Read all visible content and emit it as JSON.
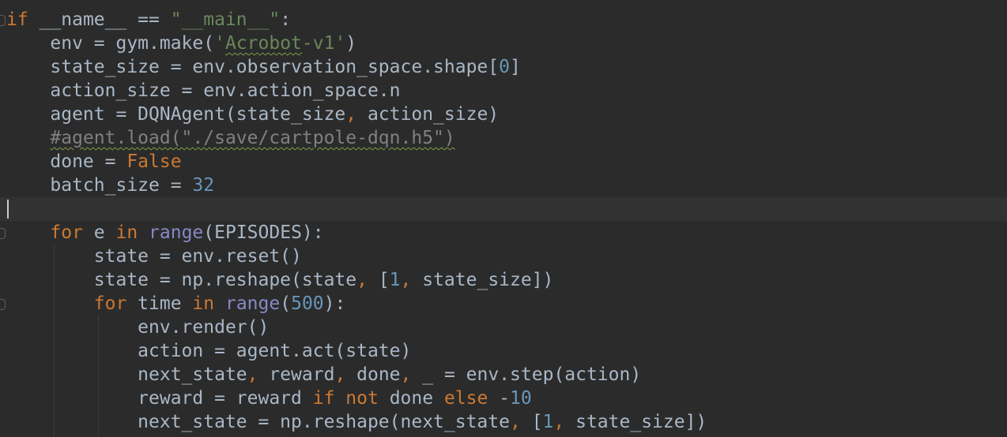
{
  "editor": {
    "language": "python",
    "theme_colors": {
      "background": "#2b2b2b",
      "text": "#a9b7c6",
      "keyword": "#cc7832",
      "string": "#6a8759",
      "number": "#6897bb",
      "builtin": "#8888c6",
      "comment": "#808080"
    },
    "lines": [
      [
        {
          "t": "if",
          "c": "kw"
        },
        {
          "t": " __name__ == "
        },
        {
          "t": "\"__main__\"",
          "c": "str"
        },
        {
          "t": ":"
        }
      ],
      [
        {
          "t": "    env = gym.make("
        },
        {
          "t": "'",
          "c": "str"
        },
        {
          "t": "Acrobot",
          "c": "str sq"
        },
        {
          "t": "-v1'",
          "c": "str"
        },
        {
          "t": ")"
        }
      ],
      [
        {
          "t": "    state_size = env.observation_space.shape["
        },
        {
          "t": "0",
          "c": "num"
        },
        {
          "t": "]"
        }
      ],
      [
        {
          "t": "    action_size = env.action_space.n"
        }
      ],
      [
        {
          "t": "    agent = DQNAgent(state_size"
        },
        {
          "t": ",",
          "c": "kw"
        },
        {
          "t": " action_size)"
        }
      ],
      [
        {
          "t": "    "
        },
        {
          "t": "#agent.load(\"./save/cartpole-dqn.h5\")",
          "c": "cm sq"
        }
      ],
      [
        {
          "t": "    done = "
        },
        {
          "t": "False",
          "c": "kw"
        }
      ],
      [
        {
          "t": "    batch_size = "
        },
        {
          "t": "32",
          "c": "num"
        }
      ],
      [
        {
          "t": ""
        }
      ],
      [
        {
          "t": "    "
        },
        {
          "t": "for",
          "c": "kw"
        },
        {
          "t": " e "
        },
        {
          "t": "in",
          "c": "kw"
        },
        {
          "t": " "
        },
        {
          "t": "range",
          "c": "bi"
        },
        {
          "t": "(EPISODES):"
        }
      ],
      [
        {
          "t": "        state = env.reset()"
        }
      ],
      [
        {
          "t": "        state = np.reshape(state"
        },
        {
          "t": ",",
          "c": "kw"
        },
        {
          "t": " ["
        },
        {
          "t": "1",
          "c": "num"
        },
        {
          "t": ",",
          "c": "kw"
        },
        {
          "t": " state_size])"
        }
      ],
      [
        {
          "t": "        "
        },
        {
          "t": "for",
          "c": "kw"
        },
        {
          "t": " time "
        },
        {
          "t": "in",
          "c": "kw"
        },
        {
          "t": " "
        },
        {
          "t": "range",
          "c": "bi"
        },
        {
          "t": "("
        },
        {
          "t": "500",
          "c": "num"
        },
        {
          "t": "):"
        }
      ],
      [
        {
          "t": "            env.render()"
        }
      ],
      [
        {
          "t": "            action = agent.act(state)"
        }
      ],
      [
        {
          "t": "            next_state"
        },
        {
          "t": ",",
          "c": "kw"
        },
        {
          "t": " reward"
        },
        {
          "t": ",",
          "c": "kw"
        },
        {
          "t": " done"
        },
        {
          "t": ",",
          "c": "kw"
        },
        {
          "t": " _ = env.step(action)"
        }
      ],
      [
        {
          "t": "            reward = reward "
        },
        {
          "t": "if",
          "c": "kw"
        },
        {
          "t": " "
        },
        {
          "t": "not",
          "c": "kw"
        },
        {
          "t": " done "
        },
        {
          "t": "else",
          "c": "kw"
        },
        {
          "t": " -"
        },
        {
          "t": "10",
          "c": "num"
        }
      ],
      [
        {
          "t": "            next_state = np.reshape(next_state"
        },
        {
          "t": ",",
          "c": "kw"
        },
        {
          "t": " ["
        },
        {
          "t": "1",
          "c": "num"
        },
        {
          "t": ",",
          "c": "kw"
        },
        {
          "t": " state_size])"
        }
      ]
    ]
  }
}
